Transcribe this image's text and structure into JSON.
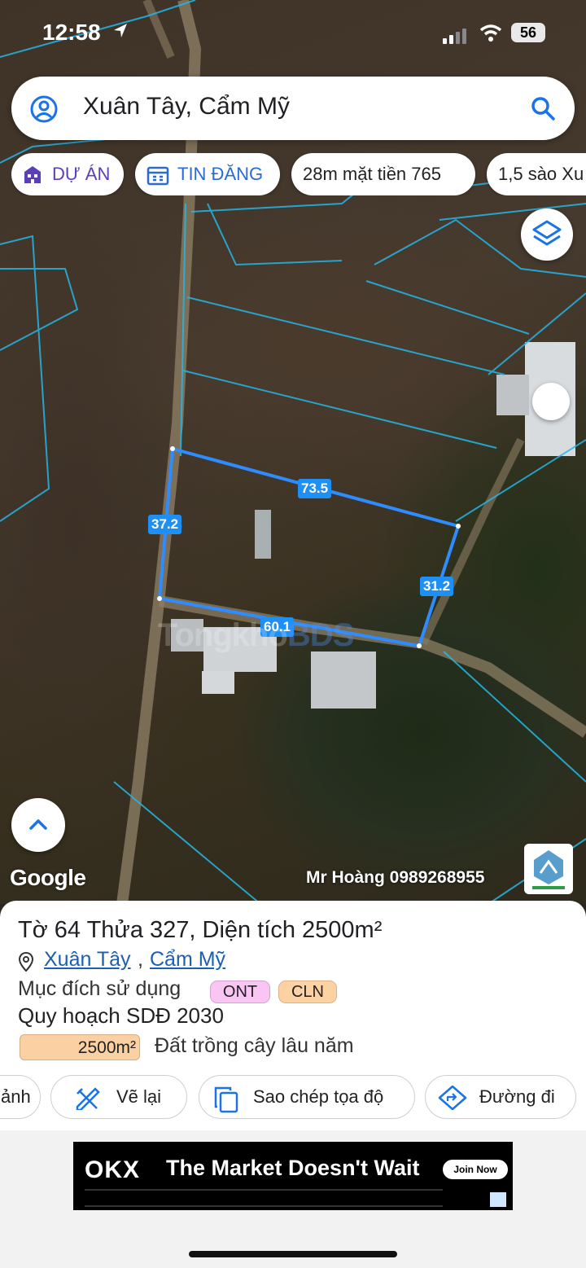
{
  "status_bar": {
    "time": "12:58",
    "battery": "56"
  },
  "search": {
    "query": "Xuân Tây, Cẩm Mỹ"
  },
  "chips": [
    {
      "label": "DỰ ÁN",
      "icon": "building-icon"
    },
    {
      "label": "TIN ĐĂNG",
      "icon": "calendar-icon"
    },
    {
      "label": "28m mặt tiền 765"
    },
    {
      "label": "1,5 sào Xu"
    }
  ],
  "map": {
    "parcel_edges": [
      "73.5",
      "37.2",
      "31.2",
      "60.1"
    ],
    "watermark": {
      "part1": "Tongkho",
      "part2": "BDS"
    },
    "attribution": "Google",
    "contact": "Mr Hoàng 0989268955"
  },
  "parcel": {
    "title": "Tờ 64 Thửa 327, Diện tích 2500m²",
    "location_1": "Xuân Tây",
    "location_sep": ",",
    "location_2": "Cẩm Mỹ",
    "purpose_label": "Mục đích sử dụng",
    "tags": [
      "ONT",
      "CLN"
    ],
    "plan_label": "Quy hoạch SDĐ 2030",
    "area": "2500m²",
    "land_type": "Đất trồng cây lâu năm"
  },
  "actions": [
    {
      "label": "ảnh"
    },
    {
      "label": "Vẽ lại",
      "icon": "draw-tool-icon"
    },
    {
      "label": "Sao chép tọa độ",
      "icon": "copy-icon"
    },
    {
      "label": "Đường đi",
      "icon": "directions-icon"
    }
  ],
  "ad": {
    "brand": "OKX",
    "slogan": "The Market Doesn't Wait",
    "cta": "Join Now"
  },
  "colors": {
    "accent": "#1e8ff5",
    "project_chip": "#5b3fb8",
    "news_chip": "#2a6bd6",
    "link": "#1a5fb4"
  }
}
